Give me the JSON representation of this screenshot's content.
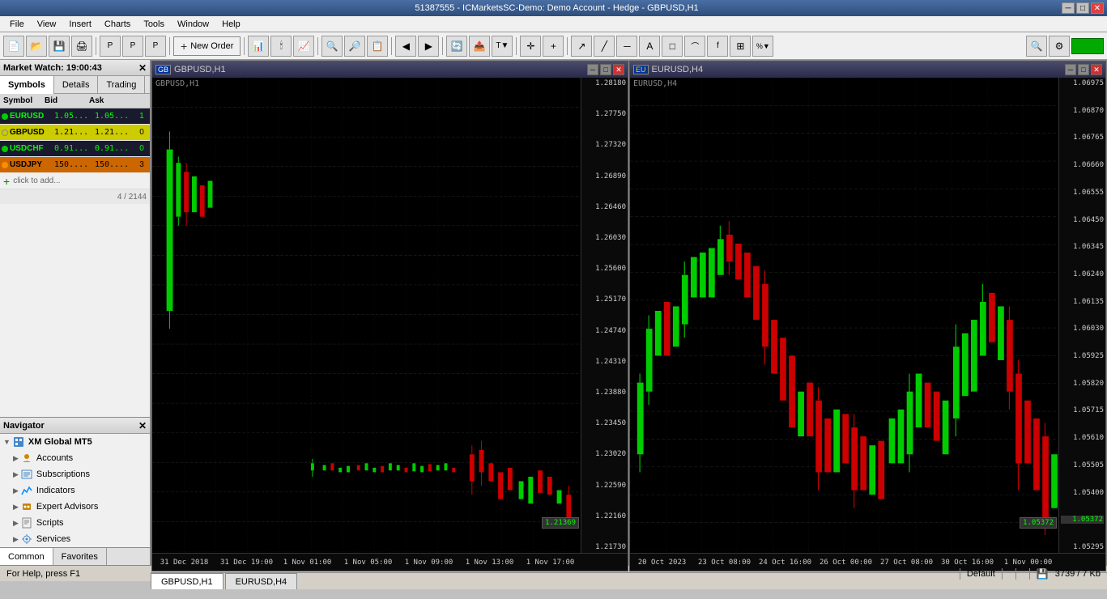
{
  "titlebar": {
    "title": "51387555 - ICMarketsSC-Demo: Demo Account - Hedge - GBPUSD,H1",
    "minimize": "─",
    "maximize": "□",
    "close": "✕"
  },
  "menubar": {
    "items": [
      "File",
      "View",
      "Insert",
      "Charts",
      "Tools",
      "Window",
      "Help"
    ]
  },
  "toolbar": {
    "new_order_label": "New Order"
  },
  "market_watch": {
    "header": "Market Watch: 19:00:43",
    "columns": [
      "Symbol",
      "Bid",
      "Ask",
      ""
    ],
    "rows": [
      {
        "symbol": "EURUSD",
        "bid": "1.05...",
        "ask": "1.05...",
        "spread": "1",
        "class": "eurusd"
      },
      {
        "symbol": "GBPUSD",
        "bid": "1.21...",
        "ask": "1.21...",
        "spread": "0",
        "class": "gbpusd"
      },
      {
        "symbol": "USDCHF",
        "bid": "0.91...",
        "ask": "0.91...",
        "spread": "0",
        "class": "usdchf"
      },
      {
        "symbol": "USDJPY",
        "bid": "150....",
        "ask": "150....",
        "spread": "3",
        "class": "usdjpy"
      }
    ],
    "footer_add": "+",
    "footer_text": "click to add...",
    "footer_count": "4 / 2144"
  },
  "mw_tabs": [
    "Symbols",
    "Details",
    "Trading"
  ],
  "navigator": {
    "header": "Navigator",
    "items": [
      {
        "label": "XM Global MT5",
        "icon": "🖥",
        "level": 0
      },
      {
        "label": "Accounts",
        "icon": "👤",
        "level": 1
      },
      {
        "label": "Subscriptions",
        "icon": "📋",
        "level": 1
      },
      {
        "label": "Indicators",
        "icon": "📊",
        "level": 1
      },
      {
        "label": "Expert Advisors",
        "icon": "🤖",
        "level": 1
      },
      {
        "label": "Scripts",
        "icon": "📄",
        "level": 1
      },
      {
        "label": "Services",
        "icon": "⚙",
        "level": 1
      }
    ]
  },
  "left_tabs": [
    "Common",
    "Favorites"
  ],
  "charts": [
    {
      "id": "gbpusd",
      "title": "GBPUSD,H1",
      "flag": "GB",
      "symbol_label": "GBPUSD,H1",
      "yaxis": [
        "1.28180",
        "1.27750",
        "1.27320",
        "1.26890",
        "1.26460",
        "1.26030",
        "1.25600",
        "1.25170",
        "1.24740",
        "1.24310",
        "1.23880",
        "1.23450",
        "1.23020",
        "1.22590",
        "1.22160",
        "1.21730"
      ],
      "xaxis": [
        "31 Dec 2018",
        "31 Dec 19:00",
        "1 Nov 01:00",
        "1 Nov 05:00",
        "1 Nov 09:00",
        "1 Nov 13:00",
        "1 Nov 17:00"
      ],
      "last_price": "1.21369"
    },
    {
      "id": "eurusd",
      "title": "EURUSD,H4",
      "flag": "EU",
      "symbol_label": "EURUSD,H4",
      "yaxis": [
        "1.06975",
        "1.06870",
        "1.06765",
        "1.06660",
        "1.06555",
        "1.06450",
        "1.06345",
        "1.06240",
        "1.06135",
        "1.06030",
        "1.05925",
        "1.05820",
        "1.05715",
        "1.05610",
        "1.05505",
        "1.05400",
        "1.05295"
      ],
      "xaxis": [
        "20 Oct 2023",
        "23 Oct 08:00",
        "24 Oct 16:00",
        "26 Oct 00:00",
        "27 Oct 08:00",
        "30 Oct 16:00",
        "1 Nov 00:00"
      ],
      "last_price": "1.05372"
    }
  ],
  "chart_tabs": [
    "GBPUSD,H1",
    "EURUSD,H4"
  ],
  "status": {
    "help_text": "For Help, press F1",
    "default_text": "Default",
    "file_info": "3739 / 7 Kb"
  }
}
